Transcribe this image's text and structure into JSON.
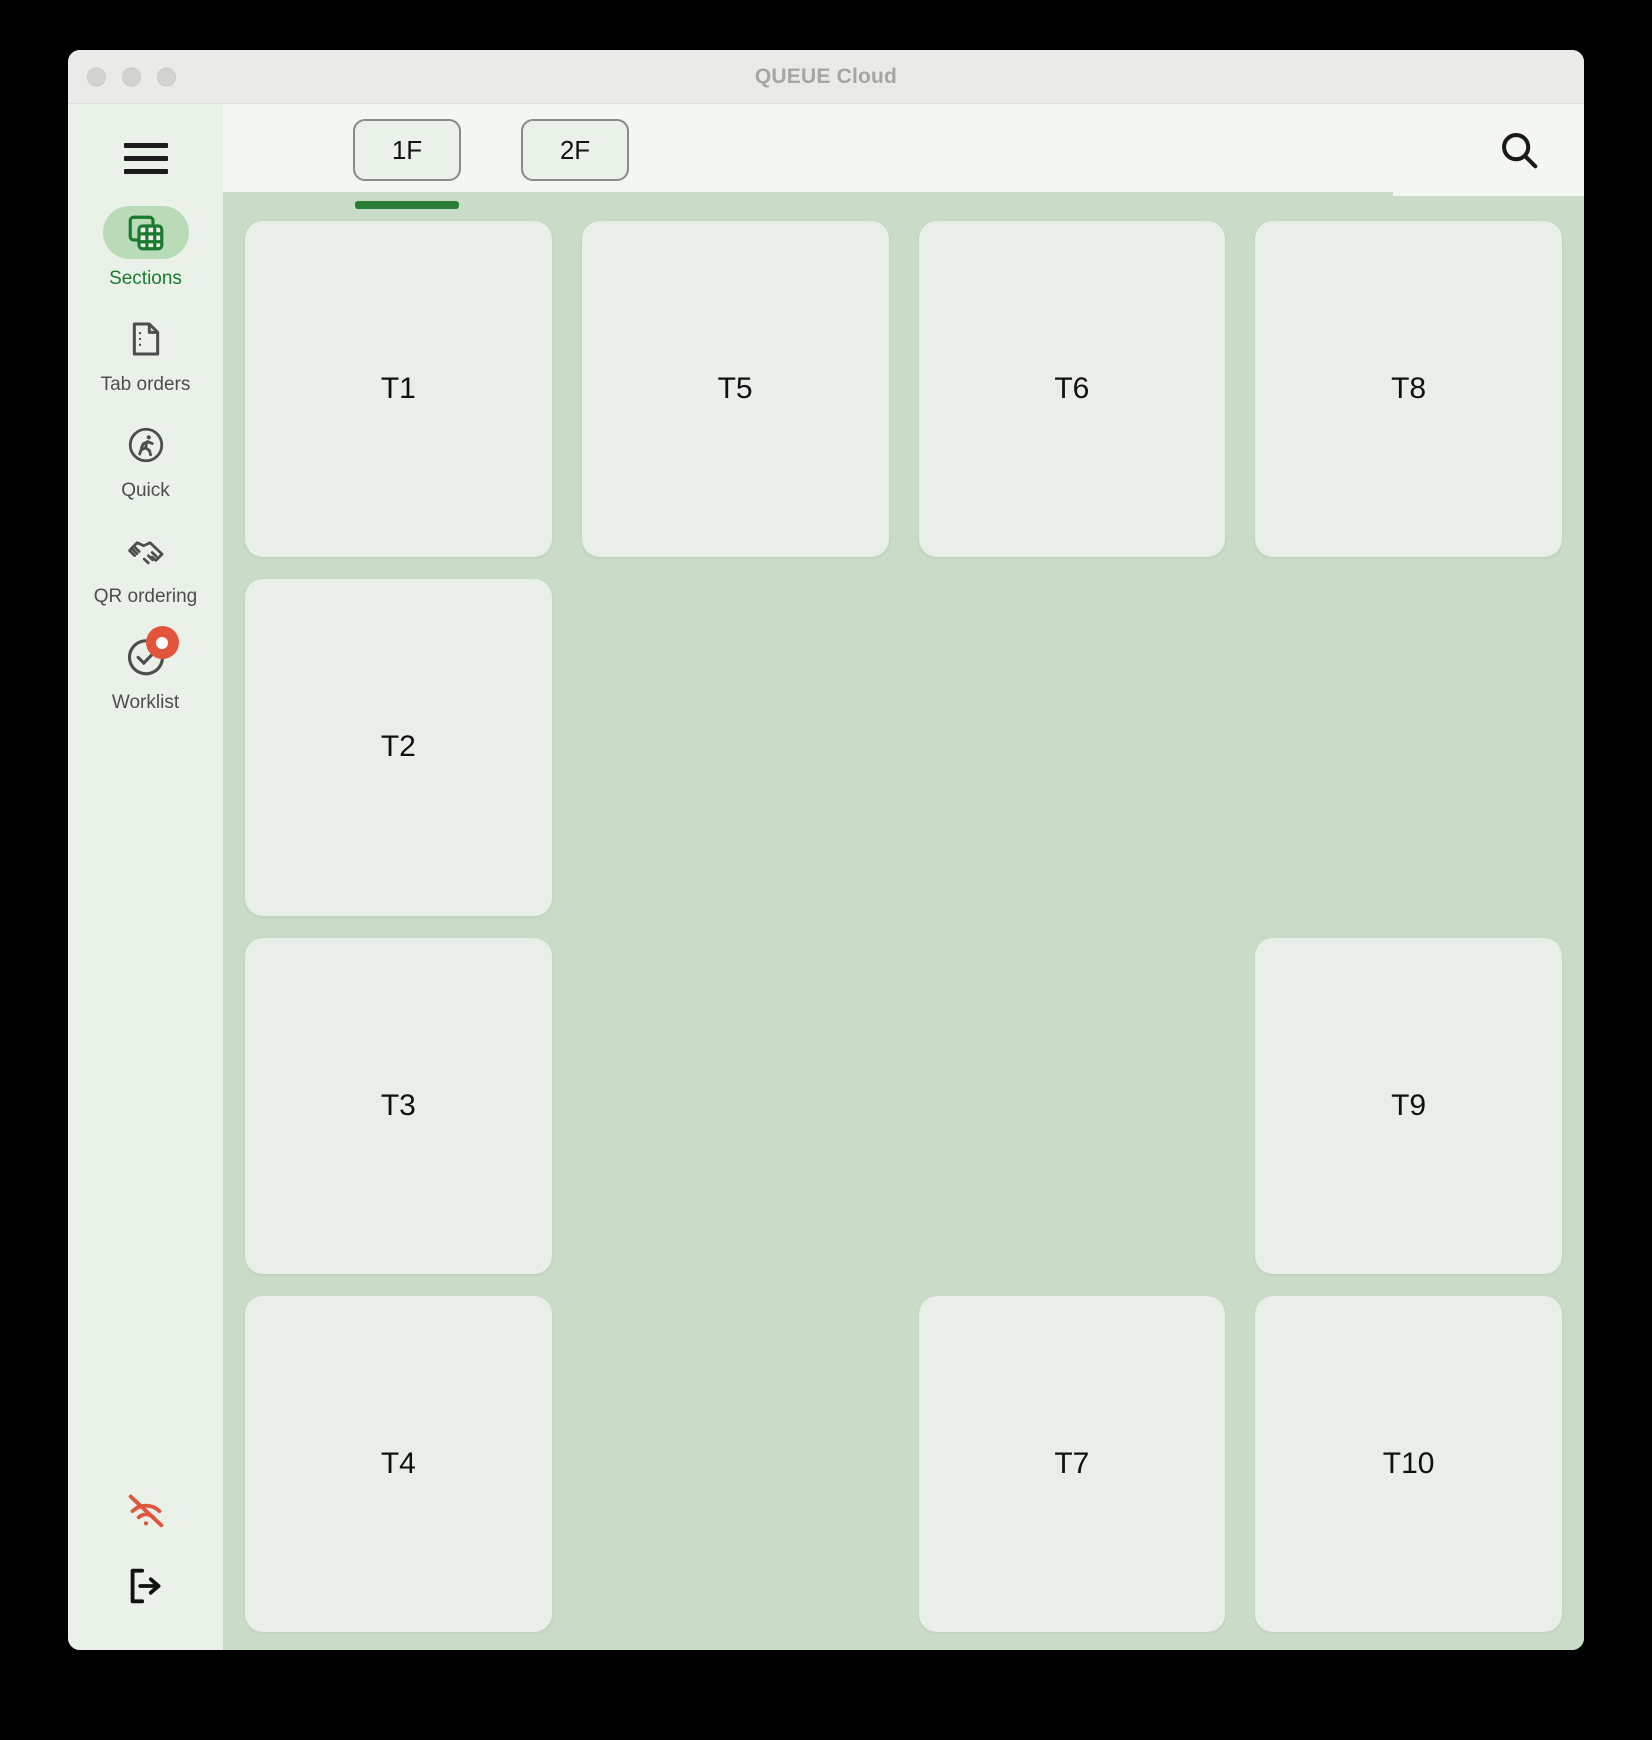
{
  "window": {
    "title": "QUEUE Cloud",
    "traffic_lights": [
      "close",
      "minimize",
      "zoom"
    ]
  },
  "sidebar": {
    "menu_icon": "hamburger-menu-icon",
    "items": [
      {
        "label": "Sections",
        "icon": "sections-grid-icon",
        "active": true,
        "badge": false
      },
      {
        "label": "Tab orders",
        "icon": "document-icon",
        "active": false,
        "badge": false
      },
      {
        "label": "Quick",
        "icon": "running-person-icon",
        "active": false,
        "badge": false
      },
      {
        "label": "QR ordering",
        "icon": "handshake-icon",
        "active": false,
        "badge": false
      },
      {
        "label": "Worklist",
        "icon": "check-circle-icon",
        "active": false,
        "badge": true
      }
    ],
    "bottom_items": [
      {
        "name": "wifi-off-icon",
        "color": "#e2543c"
      },
      {
        "name": "logout-icon",
        "color": "#111111"
      }
    ]
  },
  "toolbar": {
    "tabs": [
      {
        "label": "1F",
        "selected": true
      },
      {
        "label": "2F",
        "selected": false
      }
    ],
    "search_icon": "search-icon"
  },
  "floor_plan": {
    "rows": [
      [
        {
          "label": "T1"
        },
        {
          "label": "T5"
        },
        {
          "label": "T6"
        },
        {
          "label": "T8"
        }
      ],
      [
        {
          "label": "T2"
        },
        {
          "label": ""
        },
        {
          "label": ""
        },
        {
          "label": ""
        }
      ],
      [
        {
          "label": "T3"
        },
        {
          "label": ""
        },
        {
          "label": ""
        },
        {
          "label": "T9"
        }
      ],
      [
        {
          "label": "T4"
        },
        {
          "label": ""
        },
        {
          "label": "T7"
        },
        {
          "label": "T10"
        }
      ]
    ]
  },
  "colors": {
    "accent_green": "#2a7d34",
    "sidebar_bg": "#e9f1e9",
    "content_bg": "#c9dcc8",
    "card_bg": "#e9efe8",
    "badge_red": "#e2543c",
    "active_pill": "#b9dbb8"
  }
}
